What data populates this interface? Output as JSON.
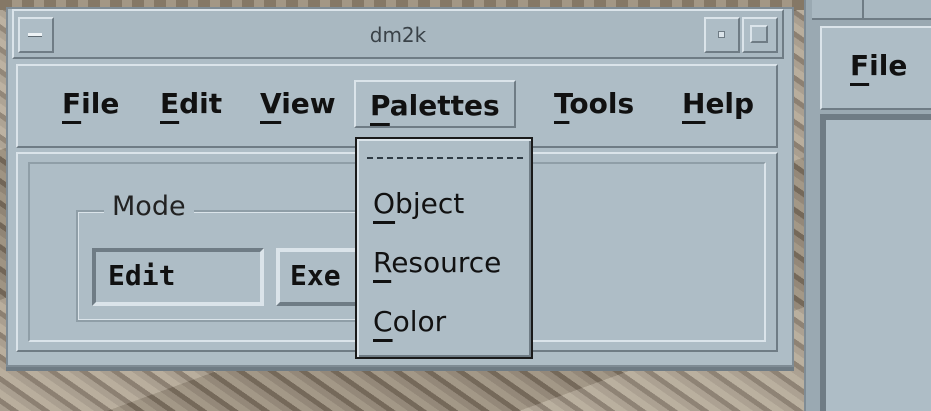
{
  "window": {
    "title": "dm2k",
    "menus": [
      {
        "mnemonic": "F",
        "rest": "ile"
      },
      {
        "mnemonic": "E",
        "rest": "dit"
      },
      {
        "mnemonic": "V",
        "rest": "iew"
      },
      {
        "mnemonic": "P",
        "rest": "alettes"
      },
      {
        "mnemonic": "T",
        "rest": "ools"
      },
      {
        "mnemonic": "H",
        "rest": "elp"
      }
    ],
    "mode": {
      "label": "Mode",
      "edit_value": "Edit",
      "execute_visible": "Exe"
    }
  },
  "palettes_menu": {
    "items": [
      {
        "mnemonic": "O",
        "rest": "bject"
      },
      {
        "mnemonic": "R",
        "rest": "esource"
      },
      {
        "mnemonic": "C",
        "rest": "olor"
      }
    ]
  },
  "second_window": {
    "menu_file": {
      "mnemonic": "F",
      "rest": "ile"
    }
  }
}
